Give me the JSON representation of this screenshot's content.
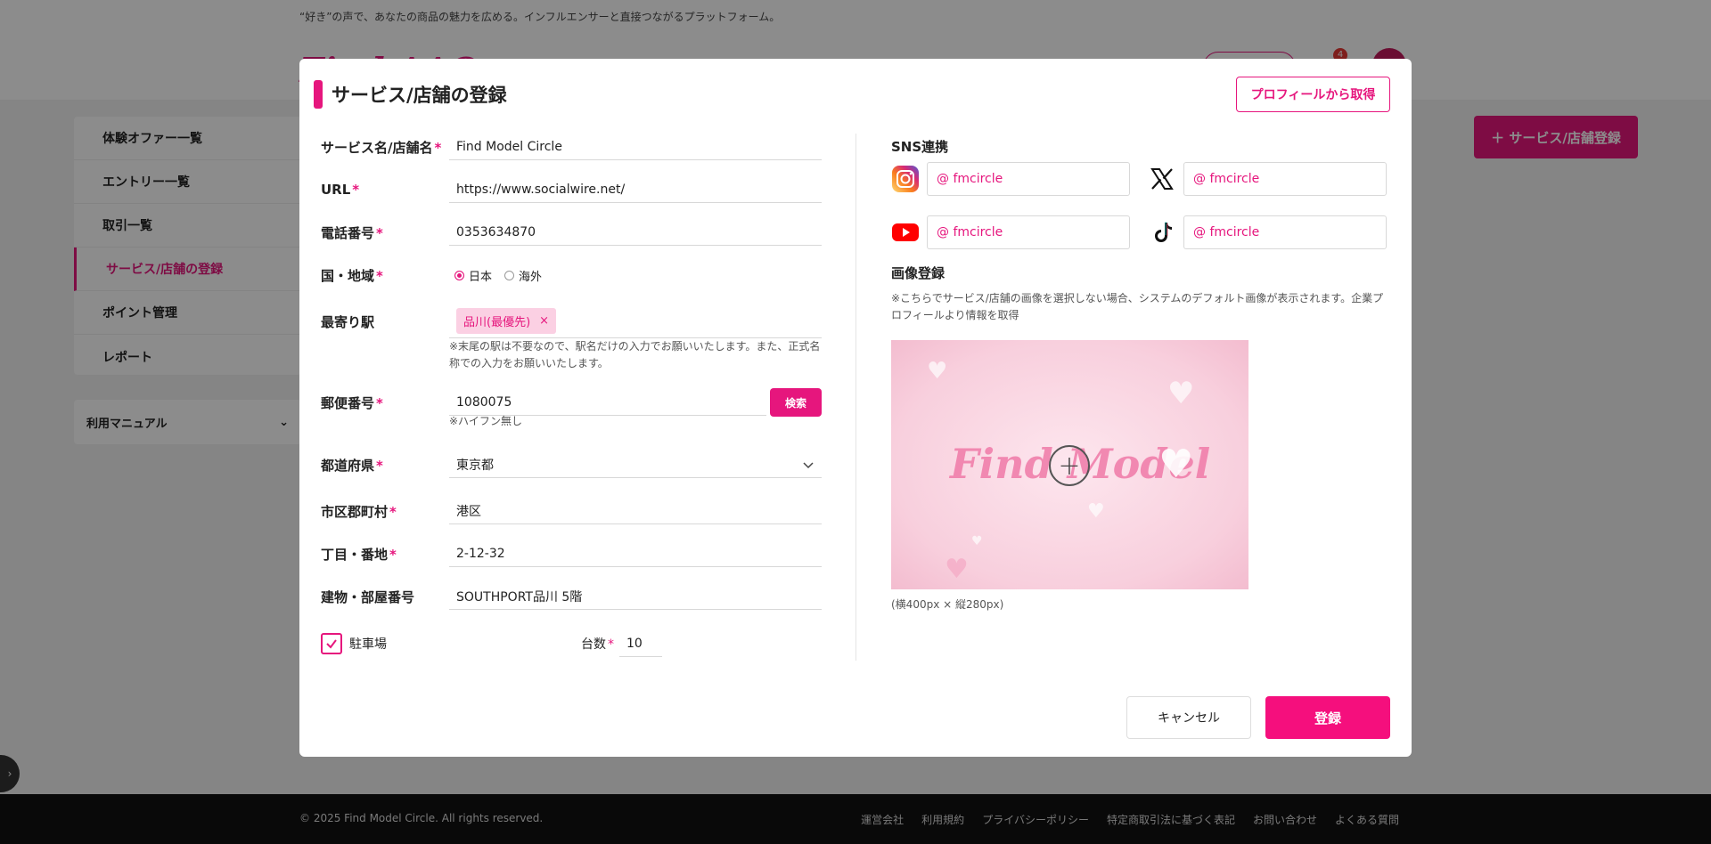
{
  "background": {
    "tagline": "“好き”の声で、あなたの商品の魅力を広める。インフルエンサーと直接つながるプラットフォーム。",
    "logo": "Find AAO",
    "notification_count": "4",
    "sidebar": {
      "items": [
        {
          "label": "体験オファー一覧"
        },
        {
          "label": "エントリー一覧"
        },
        {
          "label": "取引一覧"
        },
        {
          "label": "サービス/店舗の登録"
        },
        {
          "label": "ポイント管理"
        },
        {
          "label": "レポート"
        }
      ],
      "manual_label": "利用マニュアル"
    },
    "add_button_label": "＋ サービス/店舗登録",
    "footer": {
      "copyright": "© 2025 Find Model Circle. All rights reserved.",
      "links": [
        "運営会社",
        "利用規約",
        "プライバシーポリシー",
        "特定商取引法に基づく表記",
        "お問い合わせ",
        "よくある質問"
      ]
    }
  },
  "modal": {
    "title": "サービス/店舗の登録",
    "profile_button": "プロフィールから取得",
    "required_mark": "*",
    "fields": {
      "service_name": {
        "label": "サービス名/店舗名",
        "value": "Find Model Circle"
      },
      "url": {
        "label": "URL",
        "value": "https://www.socialwire.net/"
      },
      "phone": {
        "label": "電話番号",
        "value": "0353634870"
      },
      "country": {
        "label": "国・地域",
        "options": [
          "日本",
          "海外"
        ],
        "selected": "日本"
      },
      "station": {
        "label": "最寄り駅",
        "tag": "品川(最優先)",
        "tag_remove": "×",
        "note": "※末尾の駅は不要なので、駅名だけの入力でお願いいたします。また、正式名称での入力をお願いいたします。"
      },
      "postal": {
        "label": "郵便番号",
        "value": "1080075",
        "search_button": "検索",
        "note": "※ハイフン無し"
      },
      "prefecture": {
        "label": "都道府県",
        "value": "東京都"
      },
      "city": {
        "label": "市区郡町村",
        "value": "港区"
      },
      "address": {
        "label": "丁目・番地",
        "value": "2-12-32"
      },
      "building": {
        "label": "建物・部屋番号",
        "value": "SOUTHPORT品川 5階"
      },
      "parking": {
        "label": "駐車場",
        "checked": true
      },
      "parking_count": {
        "label": "台数",
        "value": "10"
      }
    },
    "sns": {
      "title": "SNS連携",
      "instagram": "@ fmcircle",
      "x": "@ fmcircle",
      "youtube": "@ fmcircle",
      "tiktok": "@ fmcircle"
    },
    "image": {
      "title": "画像登録",
      "note": "※こちらでサービス/店舗の画像を選択しない場合、システムのデフォルト画像が表示されます。企業プロフィールより情報を取得",
      "preview_text": "Find Model",
      "size_note": "(横400px × 縦280px)"
    },
    "cancel_button": "キャンセル",
    "submit_button": "登録",
    "accent_color": "#e6167d"
  }
}
